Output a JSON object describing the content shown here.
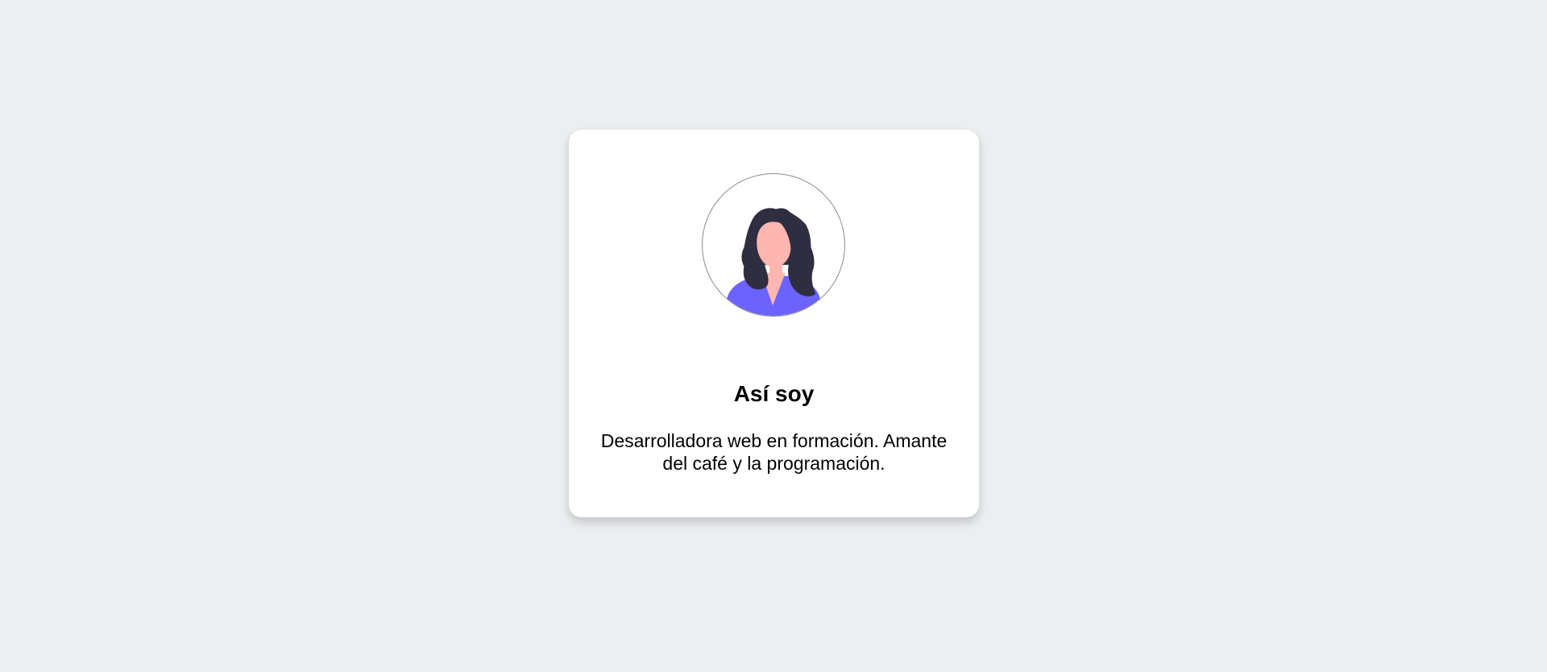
{
  "profile": {
    "title": "Así soy",
    "description": "Desarrolladora web en formación. Amante del café y la programación.",
    "avatar_icon": "woman-avatar-icon"
  },
  "colors": {
    "background": "#ebeff0",
    "card": "#ffffff",
    "hair": "#2f2e41",
    "skin": "#ffb6b0",
    "shirt": "#6c63ff"
  }
}
